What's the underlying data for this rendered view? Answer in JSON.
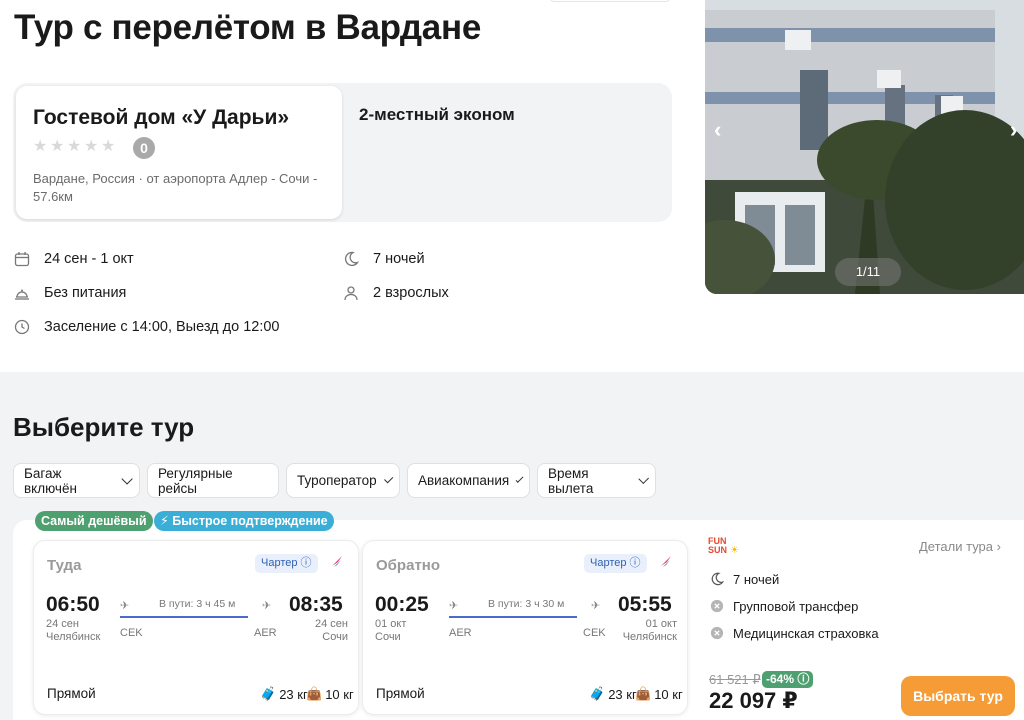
{
  "page": {
    "title": "Тур с перелётом в Вардане"
  },
  "hotel": {
    "name": "Гостевой дом «У Дарьи»",
    "rating": "0",
    "location": "Вардане, Россия · от аэропорта Адлер - Сочи - 57.6км",
    "room": "2-местный эконом"
  },
  "info": {
    "dates": "24 сен - 1 окт",
    "nights": "7 ночей",
    "meal": "Без питания",
    "guests": "2 взрослых",
    "checkin": "Заселение с 14:00, Выезд до 12:00"
  },
  "gallery": {
    "counter": "1/11"
  },
  "section": {
    "title": "Выберите тур"
  },
  "filters": [
    {
      "label": "Багаж включён"
    },
    {
      "label": "Регулярные рейсы"
    },
    {
      "label": "Туроператор"
    },
    {
      "label": "Авиакомпания"
    },
    {
      "label": "Время вылета"
    }
  ],
  "tour": {
    "badges": {
      "cheapest": "Самый дешёвый",
      "fast": "⚡ Быстрое подтверждение"
    },
    "outbound": {
      "direction": "Туда",
      "charter": "Чартер ⓘ",
      "dep_time": "06:50",
      "dep_date": "24 сен",
      "dep_city": "Челябинск",
      "arr_time": "08:35",
      "arr_date": "24 сен",
      "arr_city": "Сочи",
      "duration": "В пути: 3 ч 45 м",
      "dep_code": "CEK",
      "arr_code": "AER",
      "type": "Прямой",
      "bag": "23 кг",
      "hand": "10 кг"
    },
    "inbound": {
      "direction": "Обратно",
      "charter": "Чартер ⓘ",
      "dep_time": "00:25",
      "dep_date": "01 окт",
      "dep_city": "Сочи",
      "arr_time": "05:55",
      "arr_date": "01 окт",
      "arr_city": "Челябинск",
      "duration": "В пути: 3 ч 30 м",
      "dep_code": "AER",
      "arr_code": "CEK",
      "type": "Прямой",
      "bag": "23 кг",
      "hand": "10 кг"
    },
    "operator": {
      "logo_top": "FUN",
      "logo_bottom": "SUN"
    },
    "details_label": "Детали тура ›",
    "features": {
      "nights": "7 ночей",
      "transfer": "Групповой трансфер",
      "insurance": "Медицинская страховка"
    },
    "old_price": "61 521 ₽",
    "discount": "-64% ⓘ",
    "price": "22 097 ₽",
    "select_label": "Выбрать тур"
  },
  "colors": {
    "accent": "#f59c37",
    "green": "#4fa070",
    "blue": "#3aaed6",
    "route": "#4a6ad0"
  }
}
